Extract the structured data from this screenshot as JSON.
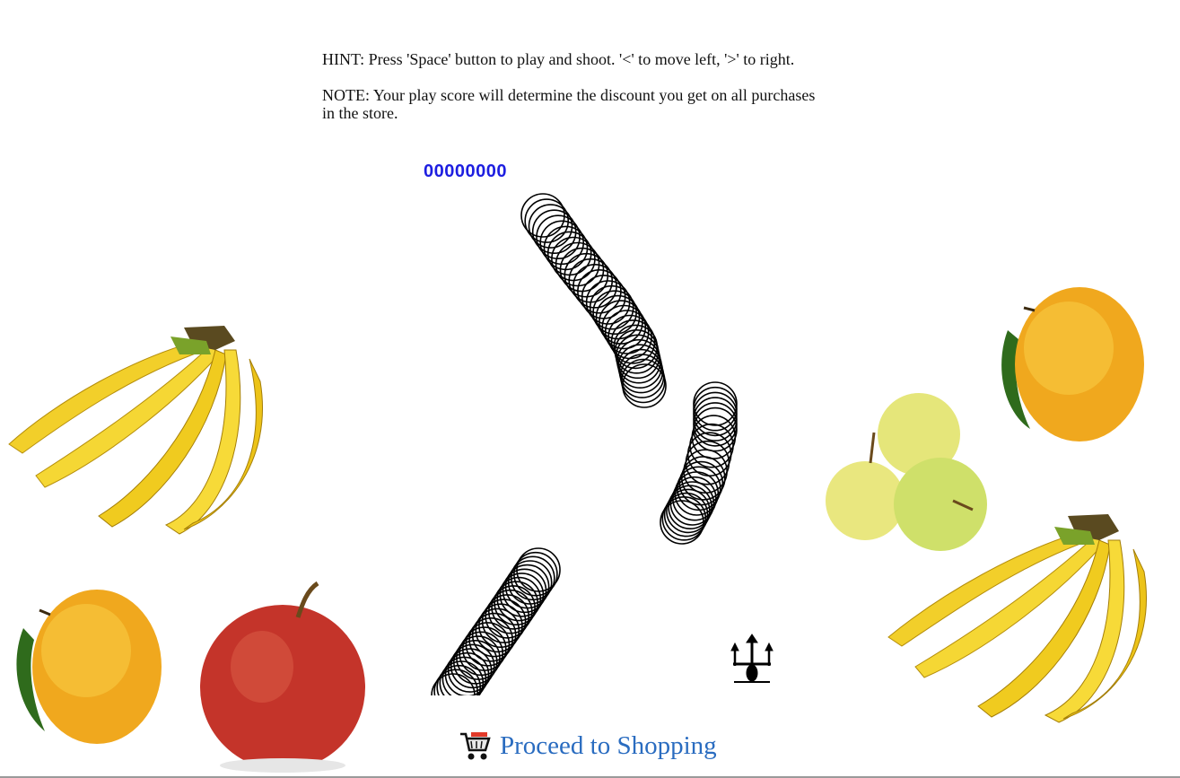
{
  "instructions": {
    "hint": "HINT: Press 'Space' button to play and shoot. '<' to move left, '>' to right.",
    "note": "NOTE: Your play score will determine the discount you get on all purchases in the store."
  },
  "game": {
    "score": "00000000",
    "enemy_color": "#000000",
    "player_icon": "trident-ship-icon"
  },
  "decorations": [
    "banana-bunch",
    "mango",
    "apples",
    "banana-bunch",
    "mango",
    "apple"
  ],
  "footer": {
    "proceed_label": "Proceed to Shopping",
    "proceed_icon": "shopping-cart-icon",
    "link_color": "#2a6cc0"
  }
}
